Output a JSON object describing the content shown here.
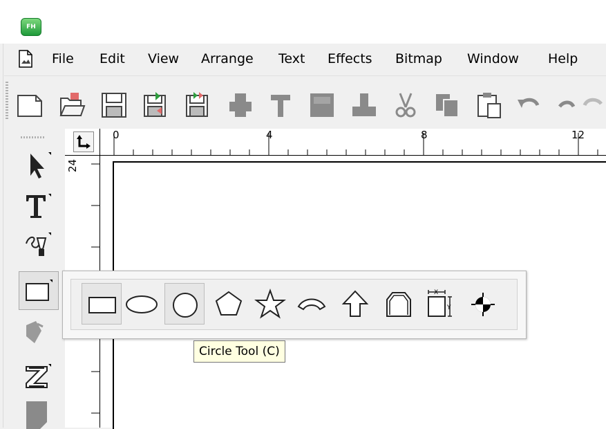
{
  "app": {
    "logo_text": "FH"
  },
  "menu": {
    "items": [
      "File",
      "Edit",
      "View",
      "Arrange",
      "Text",
      "Effects",
      "Bitmap",
      "Window",
      "Help"
    ]
  },
  "toolbar": {
    "buttons": [
      "new-document",
      "open",
      "save",
      "save-as",
      "save-all",
      "print",
      "cut-tool",
      "export",
      "import",
      "scissors",
      "copy",
      "paste",
      "undo"
    ]
  },
  "toolbox": {
    "tools": [
      "pick-tool",
      "text-tool",
      "pen-tool",
      "shape-tool",
      "fill-tool",
      "zigzag-tool",
      "other-tool"
    ]
  },
  "ruler": {
    "h_labels": [
      "0",
      "4",
      "8",
      "12"
    ],
    "v_labels": [
      "24"
    ]
  },
  "shape_flyout": {
    "tools": [
      "rectangle-tool",
      "ellipse-tool",
      "circle-tool",
      "polygon-tool",
      "star-tool",
      "arc-tool",
      "arrow-tool",
      "label-shape-tool",
      "dimension-tool",
      "registration-mark-tool"
    ],
    "selected": "circle-tool",
    "tooltip": "Circle Tool (C)"
  }
}
